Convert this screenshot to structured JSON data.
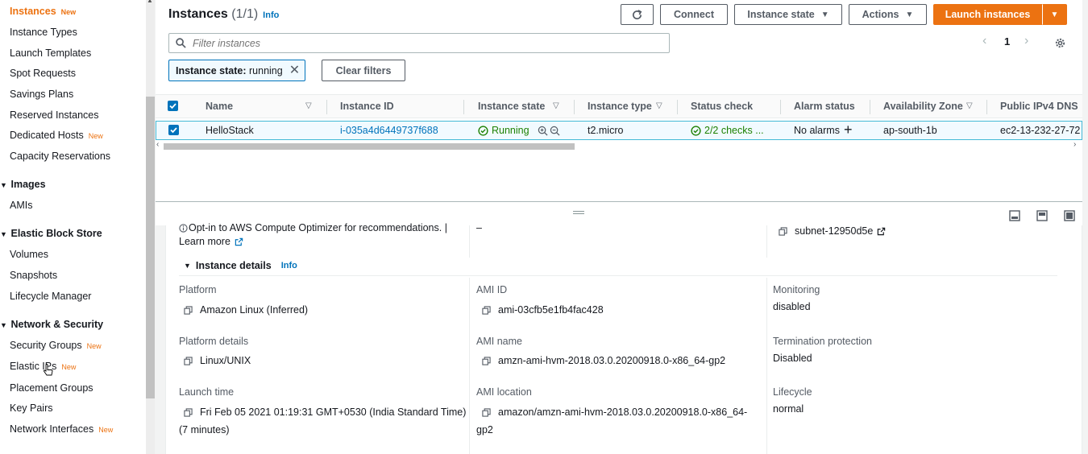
{
  "sidebar": {
    "new_badge": "New",
    "items_top": [
      {
        "label": "Instances",
        "new": true,
        "active": true
      },
      {
        "label": "Instance Types",
        "new": false
      },
      {
        "label": "Launch Templates",
        "new": false
      },
      {
        "label": "Spot Requests",
        "new": false
      },
      {
        "label": "Savings Plans",
        "new": false
      },
      {
        "label": "Reserved Instances",
        "new": false
      },
      {
        "label": "Dedicated Hosts",
        "new": true
      },
      {
        "label": "Capacity Reservations",
        "new": false
      }
    ],
    "groups": {
      "images": {
        "title": "Images",
        "items": [
          "AMIs"
        ]
      },
      "ebs": {
        "title": "Elastic Block Store",
        "items": [
          "Volumes",
          "Snapshots",
          "Lifecycle Manager"
        ]
      },
      "network": {
        "title": "Network & Security",
        "items": [
          {
            "label": "Security Groups",
            "new": true
          },
          {
            "label": "Elastic IPs",
            "new": true
          },
          {
            "label": "Placement Groups",
            "new": false
          },
          {
            "label": "Key Pairs",
            "new": false
          },
          {
            "label": "Network Interfaces",
            "new": true
          }
        ]
      }
    }
  },
  "header": {
    "title": "Instances",
    "count": "(1/1)",
    "info": "Info",
    "buttons": {
      "refresh_icon": "refresh-icon",
      "connect": "Connect",
      "instance_state": "Instance state",
      "actions": "Actions",
      "launch": "Launch instances"
    }
  },
  "filter": {
    "placeholder": "Filter instances",
    "page": "1"
  },
  "chip": {
    "key": "Instance state:",
    "value": "running",
    "clear": "Clear filters"
  },
  "table": {
    "columns": [
      "Name",
      "Instance ID",
      "Instance state",
      "Instance type",
      "Status check",
      "Alarm status",
      "Availability Zone",
      "Public IPv4 DNS"
    ],
    "rows": [
      {
        "name": "HelloStack",
        "id": "i-035a4d6449737f688",
        "state": "Running",
        "type": "t2.micro",
        "status": "2/2 checks ...",
        "alarm": "No alarms",
        "az": "ap-south-1b",
        "dns": "ec2-13-232-27-72"
      }
    ]
  },
  "details": {
    "optin_text": "Opt-in to AWS Compute Optimizer for recommendations. |",
    "learn_more": "Learn more",
    "dash": "–",
    "subnet": "subnet-12950d5e",
    "section_title": "Instance details",
    "section_info": "Info",
    "fields": {
      "platform": {
        "label": "Platform",
        "value": "Amazon Linux (Inferred)"
      },
      "ami_id": {
        "label": "AMI ID",
        "value": "ami-03cfb5e1fb4fac428"
      },
      "monitoring": {
        "label": "Monitoring",
        "value": "disabled"
      },
      "platform_details": {
        "label": "Platform details",
        "value": "Linux/UNIX"
      },
      "ami_name": {
        "label": "AMI name",
        "value": "amzn-ami-hvm-2018.03.0.20200918.0-x86_64-gp2"
      },
      "termination": {
        "label": "Termination protection",
        "value": "Disabled"
      },
      "launch_time": {
        "label": "Launch time",
        "value": "Fri Feb 05 2021 01:19:31 GMT+0530 (India Standard Time)",
        "value2": "(7 minutes)"
      },
      "ami_location": {
        "label": "AMI location",
        "value": "amazon/amzn-ami-hvm-2018.03.0.20200918.0-x86_64-",
        "value2": "gp2"
      },
      "lifecycle": {
        "label": "Lifecycle",
        "value": "normal"
      }
    }
  },
  "colors": {
    "accent": "#ec7211",
    "link": "#0073bb",
    "success": "#1d8102"
  }
}
